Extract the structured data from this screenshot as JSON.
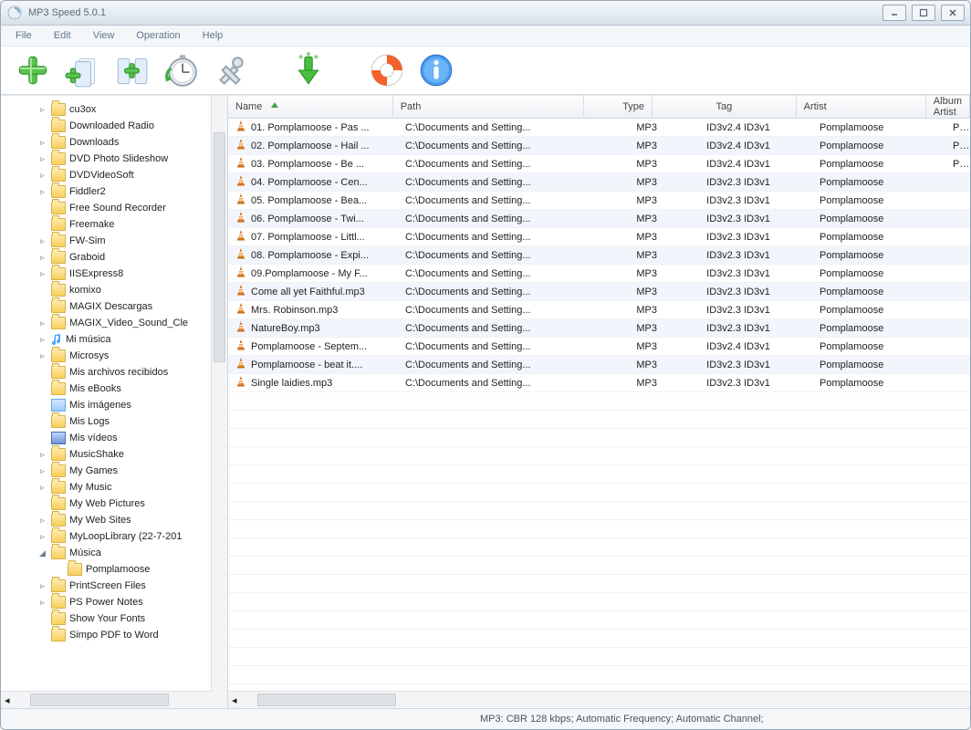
{
  "window": {
    "title": "MP3 Speed 5.0.1"
  },
  "menu": [
    "File",
    "Edit",
    "View",
    "Operation",
    "Help"
  ],
  "toolbar_icons": [
    "add",
    "add-small",
    "add-between",
    "stopwatch",
    "tools",
    "download",
    "lifebuoy",
    "info"
  ],
  "tree": [
    {
      "exp": "▹",
      "icon": "folder",
      "label": "cu3ox",
      "depth": 0
    },
    {
      "exp": "",
      "icon": "folder",
      "label": "Downloaded Radio",
      "depth": 0
    },
    {
      "exp": "▹",
      "icon": "folder",
      "label": "Downloads",
      "depth": 0
    },
    {
      "exp": "▹",
      "icon": "folder",
      "label": "DVD Photo Slideshow",
      "depth": 0
    },
    {
      "exp": "▹",
      "icon": "folder",
      "label": "DVDVideoSoft",
      "depth": 0
    },
    {
      "exp": "▹",
      "icon": "folder",
      "label": "Fiddler2",
      "depth": 0
    },
    {
      "exp": "",
      "icon": "folder",
      "label": "Free Sound Recorder",
      "depth": 0
    },
    {
      "exp": "",
      "icon": "folder",
      "label": "Freemake",
      "depth": 0
    },
    {
      "exp": "▹",
      "icon": "folder",
      "label": "FW-Sim",
      "depth": 0
    },
    {
      "exp": "▹",
      "icon": "folder",
      "label": "Graboid",
      "depth": 0
    },
    {
      "exp": "▹",
      "icon": "folder",
      "label": "IISExpress8",
      "depth": 0
    },
    {
      "exp": "",
      "icon": "folder",
      "label": "komixo",
      "depth": 0
    },
    {
      "exp": "",
      "icon": "folder",
      "label": "MAGIX Descargas",
      "depth": 0
    },
    {
      "exp": "▹",
      "icon": "folder",
      "label": "MAGIX_Video_Sound_Cle",
      "depth": 0
    },
    {
      "exp": "▹",
      "icon": "note",
      "label": "Mi música",
      "depth": 0
    },
    {
      "exp": "▹",
      "icon": "folder",
      "label": "Microsys",
      "depth": 0
    },
    {
      "exp": "",
      "icon": "folder",
      "label": "Mis archivos recibidos",
      "depth": 0
    },
    {
      "exp": "",
      "icon": "folder",
      "label": "Mis eBooks",
      "depth": 0
    },
    {
      "exp": "",
      "icon": "pic",
      "label": "Mis imágenes",
      "depth": 0
    },
    {
      "exp": "",
      "icon": "folder",
      "label": "Mis Logs",
      "depth": 0
    },
    {
      "exp": "",
      "icon": "vid",
      "label": "Mis vídeos",
      "depth": 0
    },
    {
      "exp": "▹",
      "icon": "folder",
      "label": "MusicShake",
      "depth": 0
    },
    {
      "exp": "▹",
      "icon": "folder",
      "label": "My Games",
      "depth": 0
    },
    {
      "exp": "▹",
      "icon": "folder",
      "label": "My Music",
      "depth": 0
    },
    {
      "exp": "",
      "icon": "folder",
      "label": "My Web Pictures",
      "depth": 0
    },
    {
      "exp": "▹",
      "icon": "folder",
      "label": "My Web Sites",
      "depth": 0
    },
    {
      "exp": "▹",
      "icon": "folder",
      "label": "MyLoopLibrary (22-7-201",
      "depth": 0
    },
    {
      "exp": "◢",
      "icon": "folder",
      "label": "Música",
      "depth": 0
    },
    {
      "exp": "",
      "icon": "folder",
      "label": "Pomplamoose",
      "depth": 1
    },
    {
      "exp": "▹",
      "icon": "folder",
      "label": "PrintScreen Files",
      "depth": 0
    },
    {
      "exp": "▹",
      "icon": "folder",
      "label": "PS Power Notes",
      "depth": 0
    },
    {
      "exp": "",
      "icon": "folder",
      "label": "Show Your Fonts",
      "depth": 0
    },
    {
      "exp": "",
      "icon": "folder",
      "label": "Simpo PDF to Word",
      "depth": 0
    }
  ],
  "columns": {
    "name": "Name",
    "path": "Path",
    "type": "Type",
    "tag": "Tag",
    "artist": "Artist",
    "albumartist": "Album Artist"
  },
  "rows": [
    {
      "name": "01. Pomplamoose - Pas ...",
      "path": "C:\\Documents and Setting...",
      "type": "MP3",
      "tag": "ID3v2.4  ID3v1",
      "artist": "Pomplamoose",
      "albumartist": "Pomplamoose"
    },
    {
      "name": "02. Pomplamoose - Hail ...",
      "path": "C:\\Documents and Setting...",
      "type": "MP3",
      "tag": "ID3v2.4  ID3v1",
      "artist": "Pomplamoose",
      "albumartist": "Pomplamoose"
    },
    {
      "name": "03. Pomplamoose - Be ...",
      "path": "C:\\Documents and Setting...",
      "type": "MP3",
      "tag": "ID3v2.4  ID3v1",
      "artist": "Pomplamoose",
      "albumartist": "Pomplamoose"
    },
    {
      "name": "04. Pomplamoose - Cen...",
      "path": "C:\\Documents and Setting...",
      "type": "MP3",
      "tag": "ID3v2.3  ID3v1",
      "artist": "Pomplamoose",
      "albumartist": ""
    },
    {
      "name": "05. Pomplamoose - Bea...",
      "path": "C:\\Documents and Setting...",
      "type": "MP3",
      "tag": "ID3v2.3  ID3v1",
      "artist": "Pomplamoose",
      "albumartist": ""
    },
    {
      "name": "06. Pomplamoose - Twi...",
      "path": "C:\\Documents and Setting...",
      "type": "MP3",
      "tag": "ID3v2.3  ID3v1",
      "artist": "Pomplamoose",
      "albumartist": ""
    },
    {
      "name": "07. Pomplamoose - Littl...",
      "path": "C:\\Documents and Setting...",
      "type": "MP3",
      "tag": "ID3v2.3  ID3v1",
      "artist": "Pomplamoose",
      "albumartist": ""
    },
    {
      "name": "08. Pomplamoose - Expi...",
      "path": "C:\\Documents and Setting...",
      "type": "MP3",
      "tag": "ID3v2.3  ID3v1",
      "artist": "Pomplamoose",
      "albumartist": ""
    },
    {
      "name": "09.Pomplamoose - My F...",
      "path": "C:\\Documents and Setting...",
      "type": "MP3",
      "tag": "ID3v2.3  ID3v1",
      "artist": "Pomplamoose",
      "albumartist": ""
    },
    {
      "name": "Come all yet Faithful.mp3",
      "path": "C:\\Documents and Setting...",
      "type": "MP3",
      "tag": "ID3v2.3  ID3v1",
      "artist": "Pomplamoose",
      "albumartist": ""
    },
    {
      "name": "Mrs. Robinson.mp3",
      "path": "C:\\Documents and Setting...",
      "type": "MP3",
      "tag": "ID3v2.3  ID3v1",
      "artist": "Pomplamoose",
      "albumartist": ""
    },
    {
      "name": "NatureBoy.mp3",
      "path": "C:\\Documents and Setting...",
      "type": "MP3",
      "tag": "ID3v2.3  ID3v1",
      "artist": "Pomplamoose",
      "albumartist": ""
    },
    {
      "name": "Pomplamoose - Septem...",
      "path": "C:\\Documents and Setting...",
      "type": "MP3",
      "tag": "ID3v2.4  ID3v1",
      "artist": "Pomplamoose",
      "albumartist": ""
    },
    {
      "name": "Pomplamoose - beat it....",
      "path": "C:\\Documents and Setting...",
      "type": "MP3",
      "tag": "ID3v2.3  ID3v1",
      "artist": "Pomplamoose",
      "albumartist": ""
    },
    {
      "name": "Single laidies.mp3",
      "path": "C:\\Documents and Setting...",
      "type": "MP3",
      "tag": "ID3v2.3  ID3v1",
      "artist": "Pomplamoose",
      "albumartist": ""
    }
  ],
  "status": "MP3:  CBR  128 kbps;  Automatic Frequency;  Automatic Channel;"
}
